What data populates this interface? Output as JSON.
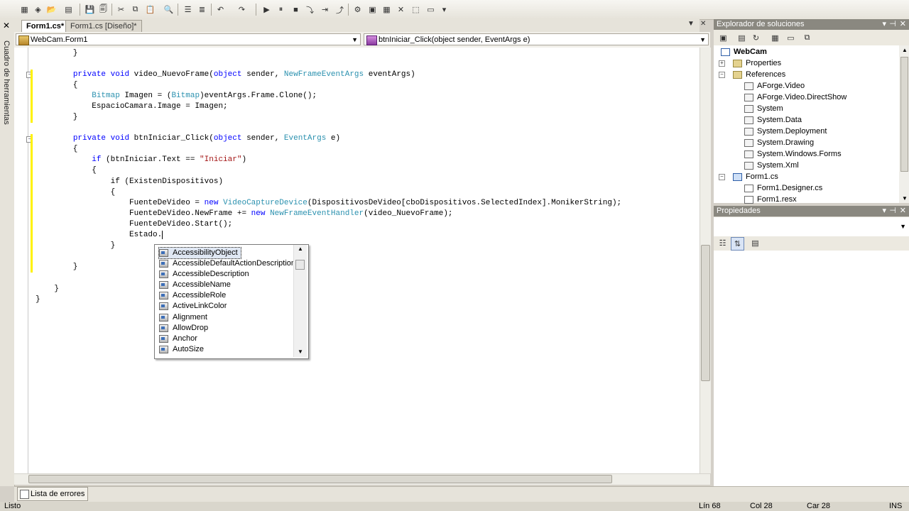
{
  "editor_tabs": {
    "form1cs": "Form1.cs*",
    "design": "Form1.cs [Diseño]*"
  },
  "nav": {
    "class_combo": "WebCam.Form1",
    "method_combo": "btnIniciar_Click(object sender, EventArgs e)"
  },
  "code": {
    "l0": "        }",
    "l1a": "        private void video_NuevoFrame(object sender, ",
    "l1b": "NewFrameEventArgs",
    "l1c": " eventArgs)",
    "l2": "        {",
    "l3a": "            ",
    "l3b": "Bitmap",
    "l3c": " Imagen = (",
    "l3d": "Bitmap",
    "l3e": ")eventArgs.Frame.Clone();",
    "l4": "            EspacioCamara.Image = Imagen;",
    "l5": "        }",
    "l6a": "        private void btnIniciar_Click(object sender, ",
    "l6b": "EventArgs",
    "l6c": " e)",
    "l7": "        {",
    "l8a": "            if (btnIniciar.Text == ",
    "l8b": "\"Iniciar\"",
    "l8c": ")",
    "l9": "            {",
    "l10": "                if (ExistenDispositivos)",
    "l11": "                {",
    "l12a": "                    FuenteDeVideo = new ",
    "l12b": "VideoCaptureDevice",
    "l12c": "(DispositivosDeVideo[cboDispositivos.SelectedIndex].MonikerString);",
    "l13a": "                    FuenteDeVideo.NewFrame += new ",
    "l13b": "NewFrameEventHandler",
    "l13c": "(video_NuevoFrame);",
    "l14": "                    FuenteDeVideo.Start();",
    "l15": "                    Estado.",
    "l16": "                }",
    "l17": "        }",
    "l18": "    }",
    "l19": "}"
  },
  "intellisense": [
    "AccessibilityObject",
    "AccessibleDefaultActionDescription",
    "AccessibleDescription",
    "AccessibleName",
    "AccessibleRole",
    "ActiveLinkColor",
    "Alignment",
    "AllowDrop",
    "Anchor",
    "AutoSize"
  ],
  "solution_explorer": {
    "title": "Explorador de soluciones",
    "tree": [
      "WebCam",
      "Properties",
      "References",
      "AForge.Video",
      "AForge.Video.DirectShow",
      "System",
      "System.Data",
      "System.Deployment",
      "System.Drawing",
      "System.Windows.Forms",
      "System.Xml",
      "Form1.cs",
      "Form1.Designer.cs",
      "Form1.resx"
    ]
  },
  "properties": {
    "title": "Propiedades"
  },
  "toolbox_label": "Cuadro de herramientas",
  "bottom": {
    "errors_tab": "Lista de errores"
  },
  "status": {
    "ready": "Listo",
    "line": "Lín 68",
    "col": "Col 28",
    "car": "Car 28",
    "mode": "INS"
  },
  "colors": {
    "keyword": "#0000ff",
    "type": "#2b91af",
    "string": "#a31515",
    "change_marker": "#fff200"
  }
}
